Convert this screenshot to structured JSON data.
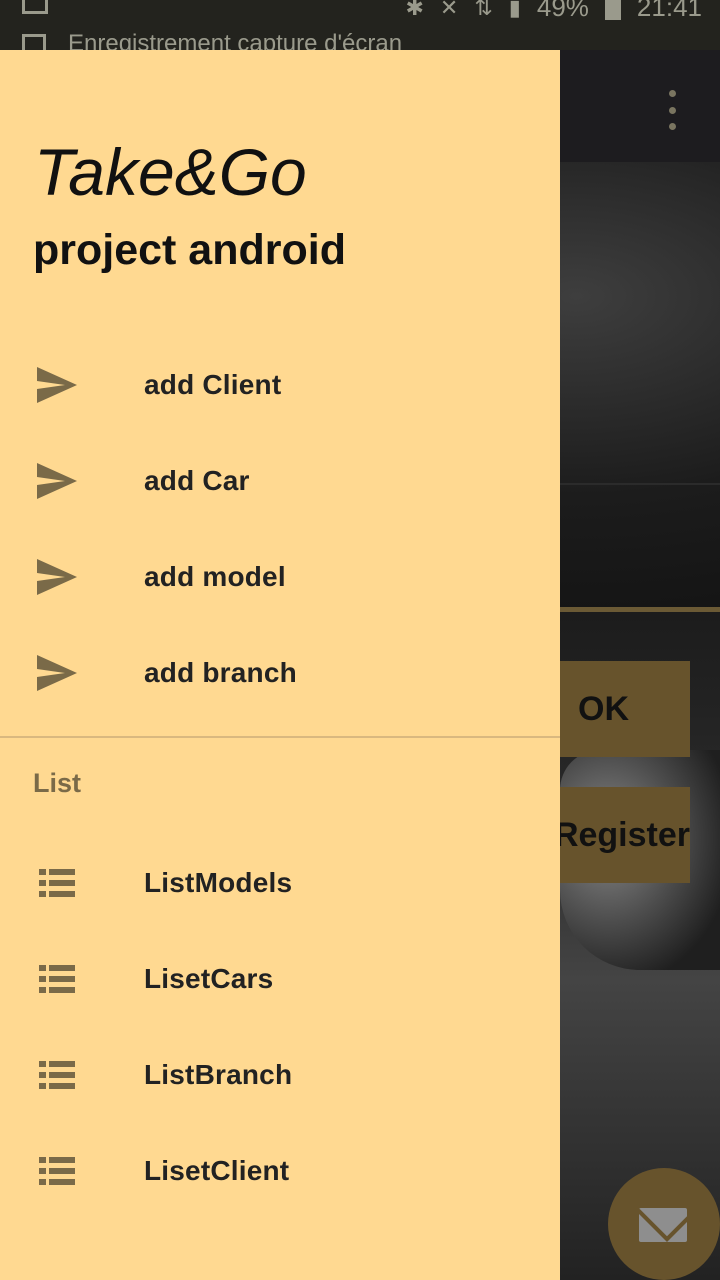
{
  "status_bar": {
    "notification_text": "Enregistrement capture d'écran",
    "battery": "49%",
    "time": "21:41"
  },
  "app": {
    "ok_button": "OK",
    "register_button": "Register"
  },
  "drawer": {
    "title": "Take&Go",
    "subtitle": "project android",
    "add_items": [
      {
        "label": "add Client",
        "icon": "send-icon"
      },
      {
        "label": "add Car",
        "icon": "send-icon"
      },
      {
        "label": "add model",
        "icon": "send-icon"
      },
      {
        "label": "add branch",
        "icon": "send-icon"
      }
    ],
    "list_section": {
      "header": "List",
      "items": [
        {
          "label": "ListModels",
          "icon": "list-icon"
        },
        {
          "label": "LisetCars",
          "icon": "list-icon"
        },
        {
          "label": "ListBranch",
          "icon": "list-icon"
        },
        {
          "label": "LisetClient",
          "icon": "list-icon"
        }
      ]
    }
  },
  "colors": {
    "drawer_bg": "#ffd991",
    "accent_brown": "#67532c",
    "icon_color": "#7a6a48"
  }
}
